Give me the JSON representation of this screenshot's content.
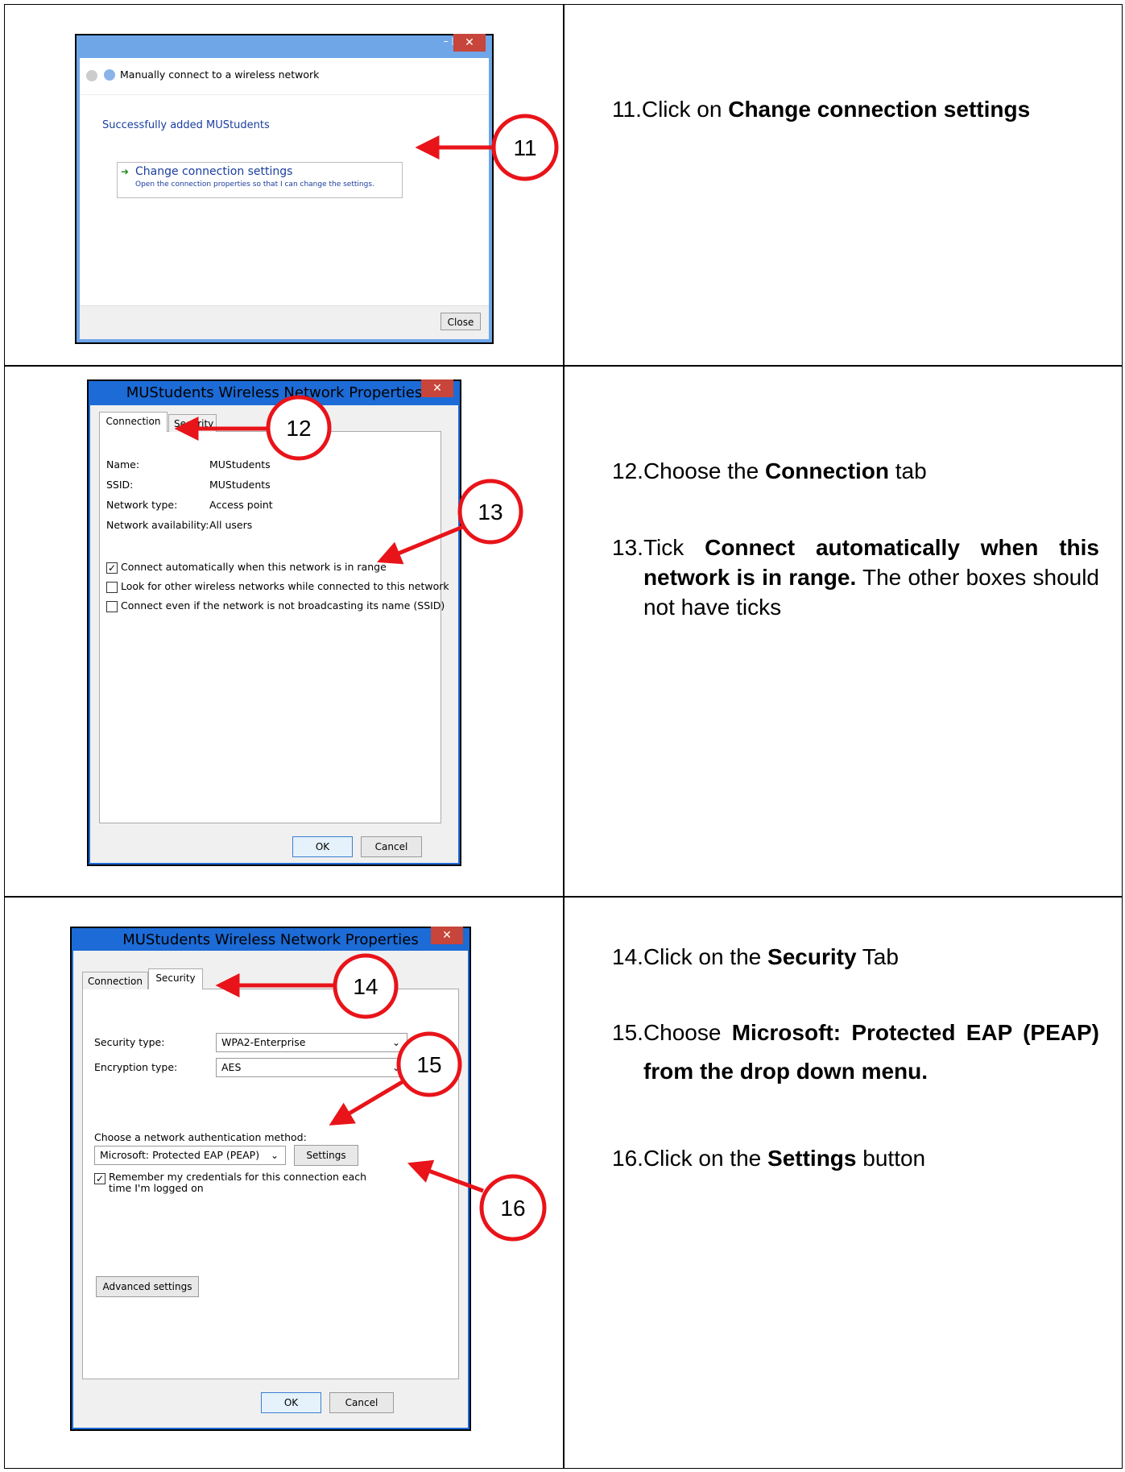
{
  "steps": {
    "s11": {
      "num": "11.",
      "pre": "Click on ",
      "bold": "Change connection settings",
      "post": ""
    },
    "s12": {
      "num": "12.",
      "pre": "Choose the ",
      "bold": "Connection",
      "post": " tab"
    },
    "s13": {
      "num": "13.",
      "pre": "Tick ",
      "bold": "Connect automatically when this network is in range.",
      "post": " The other boxes should not have ticks"
    },
    "s14": {
      "num": "14.",
      "pre": "Click on the ",
      "bold": "Security",
      "post": " Tab"
    },
    "s15": {
      "num": "15.",
      "pre": "Choose ",
      "bold": "Microsoft: Protected EAP (PEAP) from the drop down menu.",
      "post": ""
    },
    "s16": {
      "num": "16.",
      "pre": "Click on the ",
      "bold": "Settings",
      "post": " button"
    }
  },
  "callouts": {
    "c11": "11",
    "c12": "12",
    "c13": "13",
    "c14": "14",
    "c15": "15",
    "c16": "16"
  },
  "win1": {
    "title": "Manually connect to a wireless network",
    "heading": "Successfully added MUStudents",
    "option_title": "Change connection settings",
    "option_desc": "Open the connection properties so that I can change the settings.",
    "close_label": "Close",
    "minimize_glyph": "–",
    "maximize_glyph": "□",
    "close_glyph": "✕",
    "arrow_glyph": "➜"
  },
  "win2": {
    "title": "MUStudents Wireless Network Properties",
    "close_glyph": "✕",
    "tab_connection": "Connection",
    "tab_security": "Security",
    "fields": [
      {
        "label": "Name:",
        "value": "MUStudents"
      },
      {
        "label": "SSID:",
        "value": "MUStudents"
      },
      {
        "label": "Network type:",
        "value": "Access point"
      },
      {
        "label": "Network availability:",
        "value": "All users"
      }
    ],
    "check1": "Connect automatically when this network is in range",
    "check2": "Look for other wireless networks while connected to this network",
    "check3": "Connect even if the network is not broadcasting its name (SSID)",
    "check_glyph": "✓",
    "ok_label": "OK",
    "cancel_label": "Cancel"
  },
  "win3": {
    "title": "MUStudents Wireless Network Properties",
    "close_glyph": "✕",
    "tab_connection": "Connection",
    "tab_security": "Security",
    "security_type_label": "Security type:",
    "security_type_value": "WPA2-Enterprise",
    "encryption_type_label": "Encryption type:",
    "encryption_type_value": "AES",
    "auth_method_label": "Choose a network authentication method:",
    "auth_method_value": "Microsoft: Protected EAP (PEAP)",
    "settings_label": "Settings",
    "remember_label_1": "Remember my credentials for this connection each",
    "remember_label_2": "time I'm logged on",
    "advanced_label": "Advanced settings",
    "ok_label": "OK",
    "cancel_label": "Cancel",
    "check_glyph": "✓",
    "chevron_glyph": "⌄"
  },
  "colors": {
    "callout_red": "#e8141a",
    "title_blue": "#1c6bd6"
  }
}
